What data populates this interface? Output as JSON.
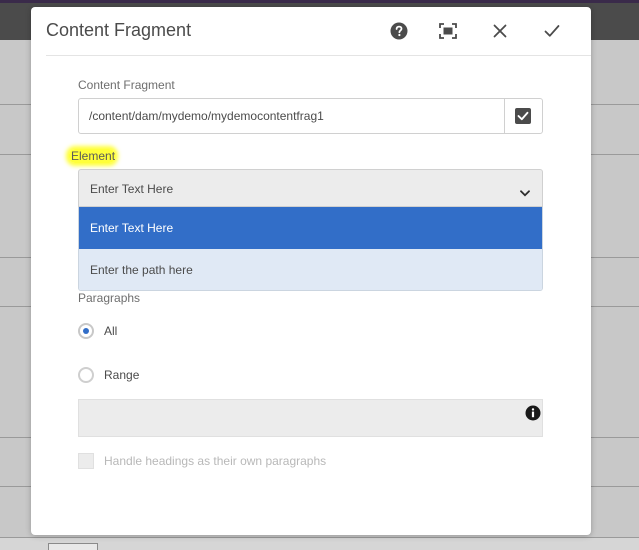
{
  "dialog": {
    "title": "Content Fragment",
    "header_icons": [
      "help-icon",
      "fullscreen-icon",
      "close-icon",
      "checkmark-icon"
    ]
  },
  "content_fragment": {
    "label": "Content Fragment",
    "path": "/content/dam/mydemo/mydemocontentfrag1",
    "browse_icon": "checkbox-browse-icon"
  },
  "element": {
    "label": "Element",
    "selected": "Enter Text Here",
    "options": [
      "Enter Text Here",
      "Enter the path here"
    ]
  },
  "paragraphs": {
    "label": "Paragraphs",
    "options": [
      {
        "label": "All",
        "checked": true
      },
      {
        "label": "Range",
        "checked": false
      }
    ],
    "range_value": "",
    "info_icon": "info-icon"
  },
  "headings_checkbox": {
    "label": "Handle headings as their own paragraphs",
    "checked": false,
    "disabled": true
  },
  "colors": {
    "accent": "#326ec8",
    "highlight": "#ffff3a"
  }
}
